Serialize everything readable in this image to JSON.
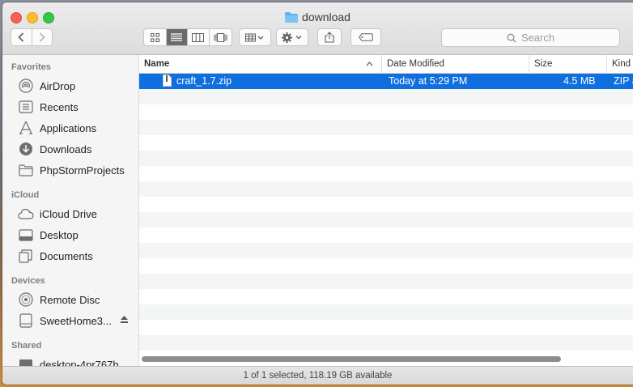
{
  "window": {
    "title": "download"
  },
  "toolbar": {
    "back_label": "Back",
    "forward_label": "Forward",
    "search_placeholder": "Search"
  },
  "sidebar": {
    "sections": [
      {
        "heading": "Favorites",
        "items": [
          {
            "label": "AirDrop",
            "icon": "airdrop-icon"
          },
          {
            "label": "Recents",
            "icon": "recents-icon"
          },
          {
            "label": "Applications",
            "icon": "applications-icon"
          },
          {
            "label": "Downloads",
            "icon": "downloads-icon"
          },
          {
            "label": "PhpStormProjects",
            "icon": "folder-icon"
          }
        ]
      },
      {
        "heading": "iCloud",
        "items": [
          {
            "label": "iCloud Drive",
            "icon": "cloud-icon"
          },
          {
            "label": "Desktop",
            "icon": "desktop-icon"
          },
          {
            "label": "Documents",
            "icon": "documents-icon"
          }
        ]
      },
      {
        "heading": "Devices",
        "items": [
          {
            "label": "Remote Disc",
            "icon": "disc-icon"
          },
          {
            "label": "SweetHome3...",
            "icon": "drive-icon"
          }
        ]
      },
      {
        "heading": "Shared",
        "items": [
          {
            "label": "desktop-4pr767b",
            "icon": "computer-icon"
          }
        ]
      }
    ]
  },
  "columns": {
    "name": "Name",
    "date": "Date Modified",
    "size": "Size",
    "kind": "Kind"
  },
  "files": [
    {
      "name": "craft_1.7.zip",
      "date": "Today at 5:29 PM",
      "size": "4.5 MB",
      "kind": "ZIP archive",
      "selected": true
    }
  ],
  "status": {
    "text": "1 of 1 selected, 118.19 GB available"
  }
}
